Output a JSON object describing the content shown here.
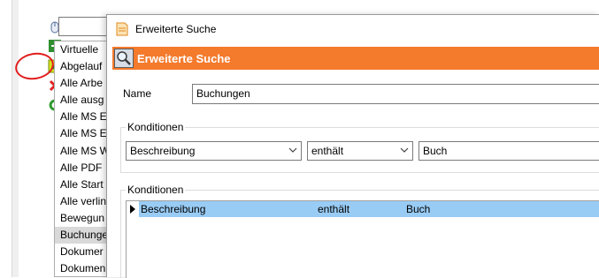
{
  "background": {
    "list_items": [
      {
        "label": "Virtuelle",
        "selected": false
      },
      {
        "label": "Abgelauf",
        "selected": false
      },
      {
        "label": "Alle Arbe",
        "selected": false
      },
      {
        "label": "Alle ausg",
        "selected": false
      },
      {
        "label": "Alle MS E",
        "selected": false
      },
      {
        "label": "Alle MS E",
        "selected": false
      },
      {
        "label": "Alle MS W",
        "selected": false
      },
      {
        "label": "Alle PDF",
        "selected": false
      },
      {
        "label": "Alle Start",
        "selected": false
      },
      {
        "label": "Alle verlin",
        "selected": false
      },
      {
        "label": "Bewegun",
        "selected": false
      },
      {
        "label": "Buchunge",
        "selected": true
      },
      {
        "label": "Dokumer",
        "selected": false
      },
      {
        "label": "Dokumen",
        "selected": false
      }
    ],
    "toolbar_icons": [
      "mouse-icon",
      "enter-icon",
      "edit-icon",
      "delete-icon",
      "refresh-icon"
    ],
    "annotation_color": "#e11d1d"
  },
  "dialog": {
    "window_title": "Erweiterte Suche",
    "header_title": "Erweiterte Suche",
    "header_color": "#f47a2c",
    "name_label": "Name",
    "name_value": "Buchungen",
    "conditions_group_label": "Konditionen",
    "field_select": "Beschreibung",
    "operator_select": "enthält",
    "value_input": "Buch",
    "conditions_list_label": "Konditionen",
    "conditions": [
      {
        "field": "Beschreibung",
        "operator": "enthält",
        "value": "Buch"
      }
    ],
    "selection_color": "#99ccf5"
  }
}
